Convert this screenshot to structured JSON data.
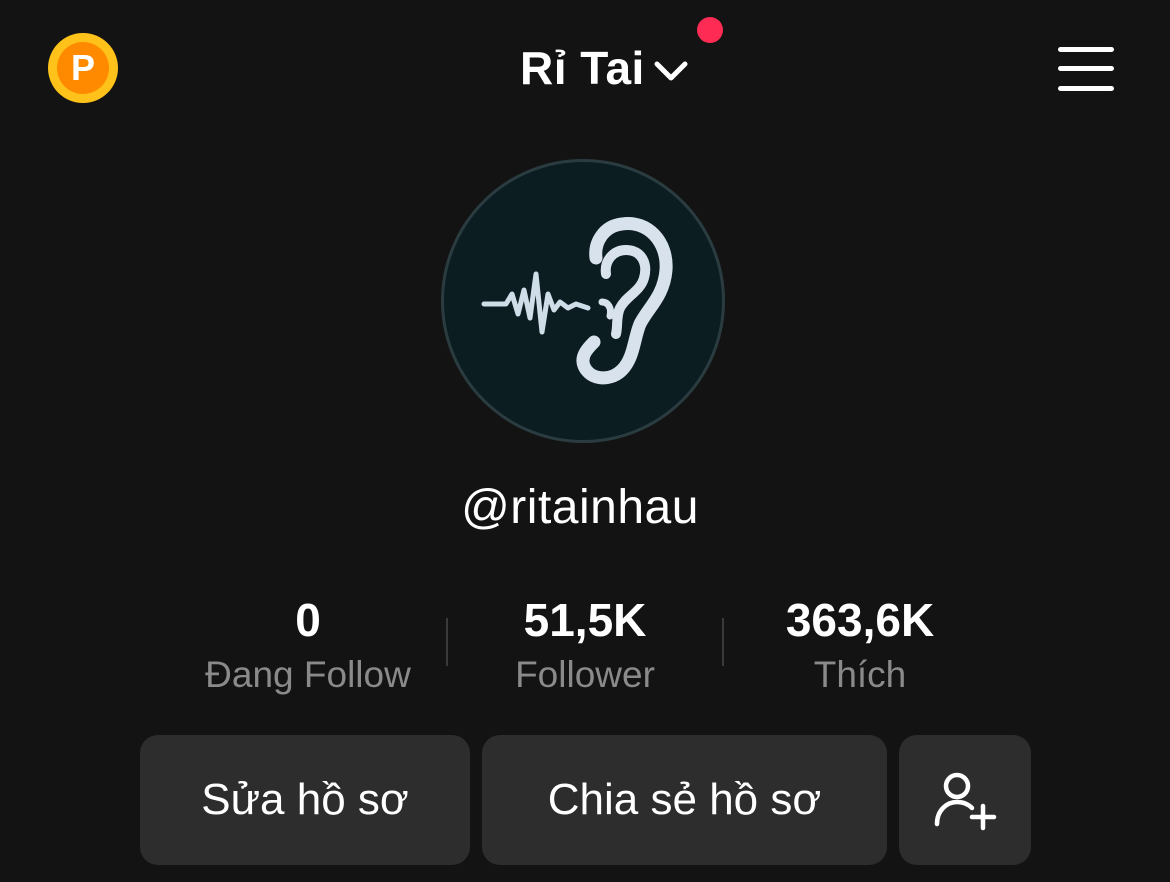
{
  "header": {
    "title": "Rỉ Tai",
    "coin_letter": "P"
  },
  "profile": {
    "username": "@ritainhau"
  },
  "stats": [
    {
      "value": "0",
      "label": "Đang Follow"
    },
    {
      "value": "51,5K",
      "label": "Follower"
    },
    {
      "value": "363,6K",
      "label": "Thích"
    }
  ],
  "actions": {
    "edit_profile": "Sửa hồ sơ",
    "share_profile": "Chia sẻ hồ sơ"
  },
  "icons": {
    "coin": "points-coin-icon",
    "chevron": "chevron-down-icon",
    "menu": "hamburger-menu-icon",
    "add_friend": "add-friend-icon"
  },
  "colors": {
    "background": "#131313",
    "notification_dot": "#fe2c55",
    "coin_outer": "#ffc21a",
    "coin_inner": "#ff8a00",
    "button_bg": "#2d2d2d",
    "secondary_text": "#8a8a8a"
  }
}
